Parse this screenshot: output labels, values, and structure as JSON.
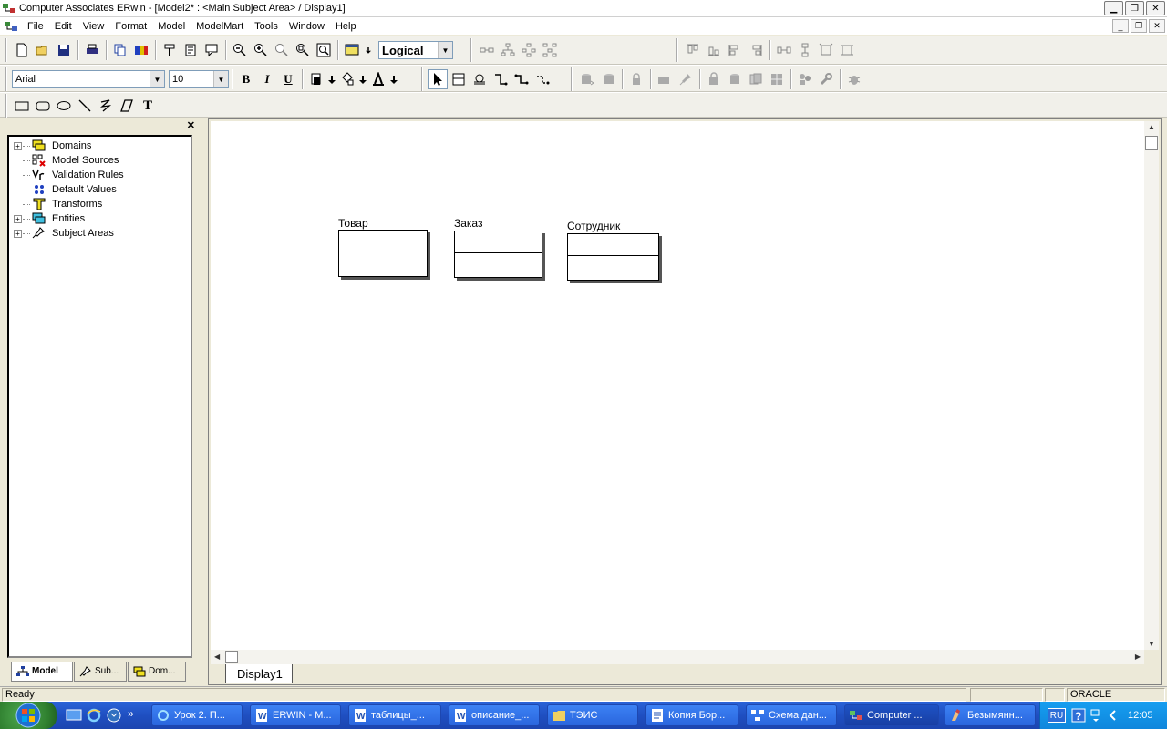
{
  "window": {
    "title": "Computer Associates ERwin - [Model2* : <Main Subject Area> / Display1]",
    "min_glyph": "▁",
    "restore_glyph": "❐",
    "close_glyph": "✕"
  },
  "menu": {
    "items": [
      "File",
      "Edit",
      "View",
      "Format",
      "Model",
      "ModelMart",
      "Tools",
      "Window",
      "Help"
    ],
    "mdi_min": "_",
    "mdi_restore": "❐",
    "mdi_close": "✕"
  },
  "toolbar": {
    "model_type": "Logical",
    "font_name": "Arial",
    "font_size": "10",
    "bold_label": "B",
    "italic_label": "I",
    "underline_label": "U",
    "text_tool_label": "T"
  },
  "tree": {
    "close_label": "✕",
    "items": [
      {
        "label": "Domains",
        "expandable": true,
        "icon": "domains-icon"
      },
      {
        "label": "Model Sources",
        "expandable": false,
        "icon": "model-sources-icon"
      },
      {
        "label": "Validation Rules",
        "expandable": false,
        "icon": "validation-rules-icon"
      },
      {
        "label": "Default Values",
        "expandable": false,
        "icon": "default-values-icon"
      },
      {
        "label": "Transforms",
        "expandable": false,
        "icon": "transforms-icon"
      },
      {
        "label": "Entities",
        "expandable": true,
        "icon": "entities-icon"
      },
      {
        "label": "Subject Areas",
        "expandable": true,
        "icon": "subject-areas-icon"
      }
    ],
    "expand_glyph": "+"
  },
  "panel_tabs": [
    {
      "label": "Model",
      "active": true
    },
    {
      "label": "Sub...",
      "active": false
    },
    {
      "label": "Dom...",
      "active": false
    }
  ],
  "diagram": {
    "entities": [
      {
        "name": "Товар"
      },
      {
        "name": "Заказ"
      },
      {
        "name": "Сотрудник"
      }
    ],
    "display_tab": "Display1"
  },
  "status": {
    "text": "Ready",
    "target": "ORACLE"
  },
  "taskbar": {
    "more_glyph": "»",
    "tasks": [
      {
        "label": "Урок 2. П...",
        "active": false
      },
      {
        "label": "ERWIN - M...",
        "active": false
      },
      {
        "label": "таблицы_...",
        "active": false
      },
      {
        "label": "описание_...",
        "active": false
      },
      {
        "label": "ТЭИС",
        "active": false
      },
      {
        "label": "Копия Бор...",
        "active": false
      },
      {
        "label": "Схема дан...",
        "active": false
      },
      {
        "label": "Computer ...",
        "active": true
      },
      {
        "label": "Безымянн...",
        "active": false
      }
    ],
    "language": "RU",
    "clock": "12:05"
  }
}
